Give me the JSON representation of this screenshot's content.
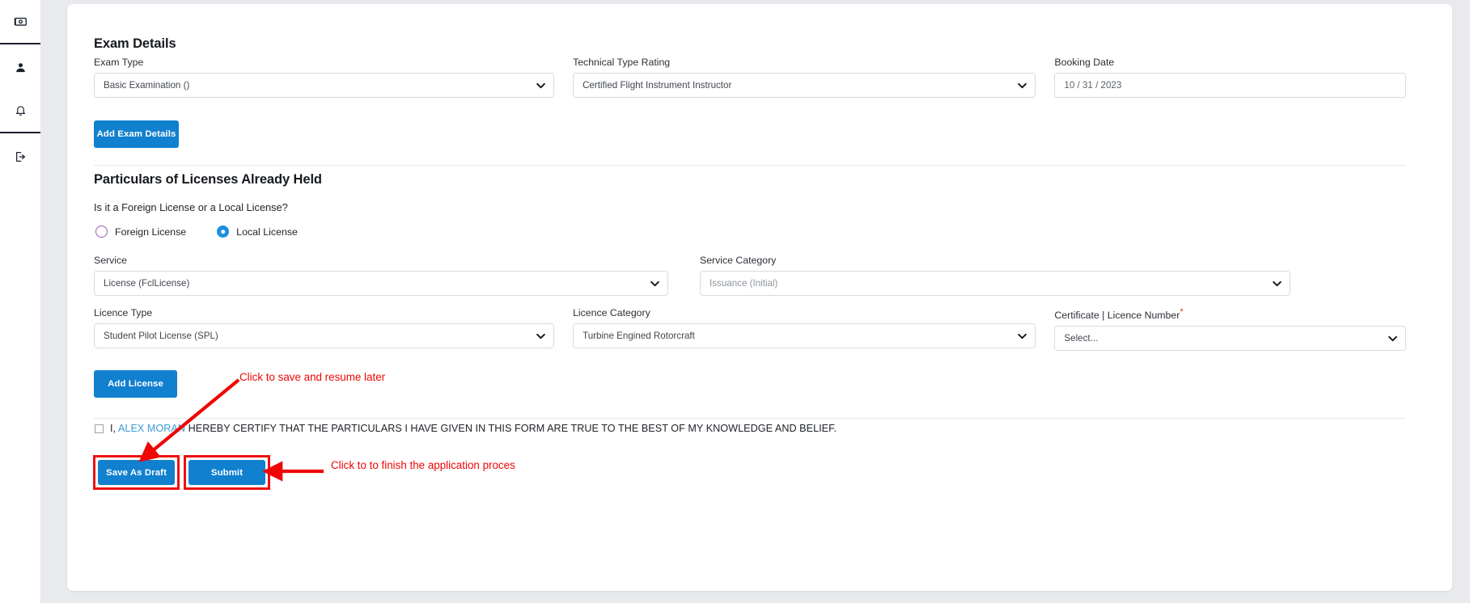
{
  "sidebar": {
    "items": [
      {
        "name": "id-card-icon",
        "label": "Applications"
      },
      {
        "name": "person-icon",
        "label": "Profile"
      },
      {
        "name": "bell-icon",
        "label": "Notifications"
      },
      {
        "name": "logout-icon",
        "label": "Logout"
      }
    ]
  },
  "exam": {
    "title": "Exam Details",
    "exam_type_label": "Exam Type",
    "exam_type_value": "Basic Examination ()",
    "technical_type_rating_label": "Technical Type Rating",
    "technical_type_rating_value": "Certified Flight Instrument Instructor",
    "booking_date_label": "Booking Date",
    "booking_date_value": "10 / 31 / 2023",
    "add_exam_button": "Add Exam Details"
  },
  "licenses": {
    "title": "Particulars of Licenses Already Held",
    "question": "Is it a Foreign License or a Local License?",
    "radios": [
      {
        "label": "Foreign License",
        "selected": false
      },
      {
        "label": "Local License",
        "selected": true
      }
    ],
    "service_label": "Service",
    "service_value": "License (FclLicense)",
    "service_category_label": "Service Category",
    "service_category_value": "Issuance (Initial)",
    "licence_type_label": "Licence Type",
    "licence_type_value": "Student Pilot License (SPL)",
    "licence_category_label": "Licence Category",
    "licence_category_value": "Turbine Engined Rotorcraft",
    "certificate_number_label": "Certificate | Licence Number",
    "certificate_number_required": "*",
    "certificate_number_value": "Select...",
    "add_license_button": "Add License"
  },
  "declaration": {
    "prefix": "I, ",
    "name": "ALEX MORAN",
    "suffix": " HEREBY CERTIFY THAT THE PARTICULARS I HAVE GIVEN IN THIS FORM ARE TRUE TO THE BEST OF MY KNOWLEDGE AND BELIEF."
  },
  "actions": {
    "save_draft_label": "Save As Draft",
    "submit_label": "Submit"
  },
  "annotations": [
    {
      "text": "Click to save and resume later"
    },
    {
      "text": "Click to to finish the application proces"
    }
  ],
  "colors": {
    "primary_blue": "#1180cf",
    "annotation_red": "#f00505",
    "radio_selected": "#1a8fe0",
    "radio_unselected_ring": "#9b59b6",
    "link_blue": "#3c9ad6",
    "page_bg": "#e9eaee"
  }
}
